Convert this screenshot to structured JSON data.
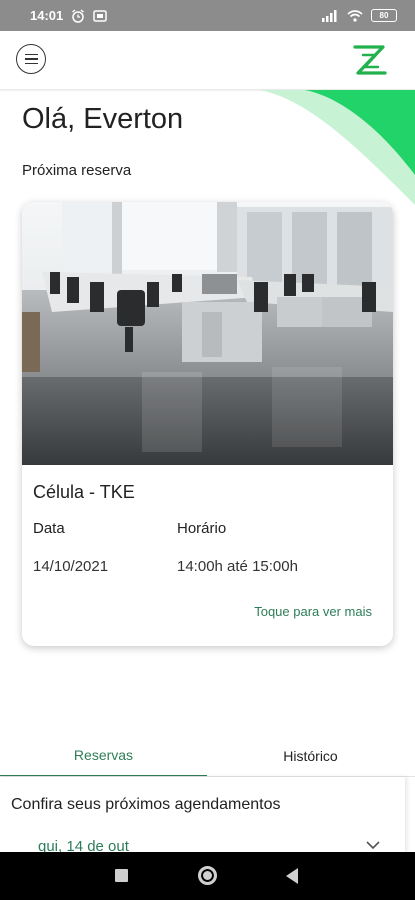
{
  "status_bar": {
    "time": "14:01",
    "battery": "80"
  },
  "header": {
    "menu_icon": "hamburger-circle-icon",
    "logo_icon": "z-brand-logo",
    "brand_color": "#22b14c"
  },
  "greeting": "Olá, Everton",
  "next_reservation": {
    "label": "Próxima reserva",
    "title": "Célula - TKE",
    "date_label": "Data",
    "date_value": "14/10/2021",
    "time_label": "Horário",
    "time_value": "14:00h até 15:00h",
    "see_more": "Toque para ver mais",
    "image": "office-open-space-photo"
  },
  "tabs": [
    {
      "label": "Reservas",
      "active": true
    },
    {
      "label": "Histórico",
      "active": false
    }
  ],
  "schedule": {
    "heading": "Confira seus próximos agendamentos",
    "days": [
      {
        "label": "qui, 14 de out"
      }
    ]
  },
  "colors": {
    "accent": "#2e7d5a",
    "status_bar": "#8c8c8c"
  }
}
